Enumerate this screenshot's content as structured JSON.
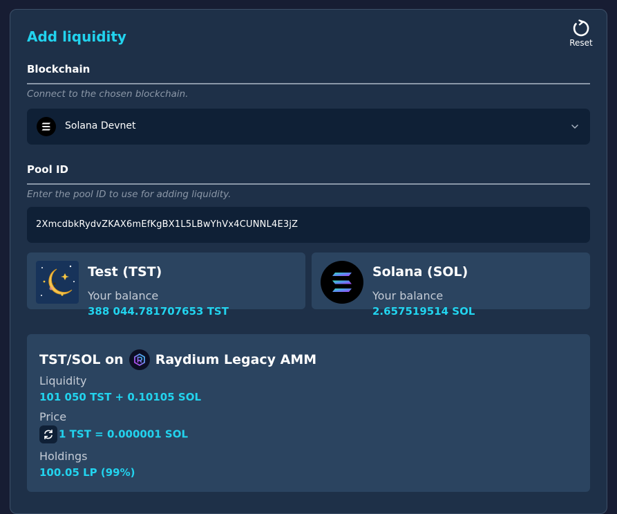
{
  "header": {
    "title": "Add liquidity",
    "reset_label": "Reset"
  },
  "blockchain": {
    "label": "Blockchain",
    "hint": "Connect to the chosen blockchain.",
    "selected": "Solana Devnet"
  },
  "pool": {
    "label": "Pool ID",
    "hint": "Enter the pool ID to use for adding liquidity.",
    "value": "2XmcdbkRydvZKAX6mEfKgBX1L5LBwYhVx4CUNNL4E3jZ"
  },
  "tokens": [
    {
      "name": "Test (TST)",
      "balance_label": "Your balance",
      "balance": "388 044.781707653 TST"
    },
    {
      "name": "Solana (SOL)",
      "balance_label": "Your balance",
      "balance": "2.657519514 SOL"
    }
  ],
  "pool_info": {
    "pair": "TST/SOL on",
    "amm": "Raydium Legacy AMM",
    "liquidity_label": "Liquidity",
    "liquidity_value": "101 050 TST + 0.10105 SOL",
    "price_label": "Price",
    "price_value": "1 TST = 0.000001 SOL",
    "holdings_label": "Holdings",
    "holdings_value": "100.05 LP (99%)"
  },
  "colors": {
    "accent": "#22d3ee",
    "panel": "#1e3048",
    "card": "#2b4460",
    "field": "#0f2036"
  },
  "icons": [
    "reset-icon",
    "solana-logo-icon",
    "chevron-down-icon",
    "tst-token-icon",
    "sol-token-icon",
    "raydium-logo-icon",
    "swap-icon"
  ]
}
